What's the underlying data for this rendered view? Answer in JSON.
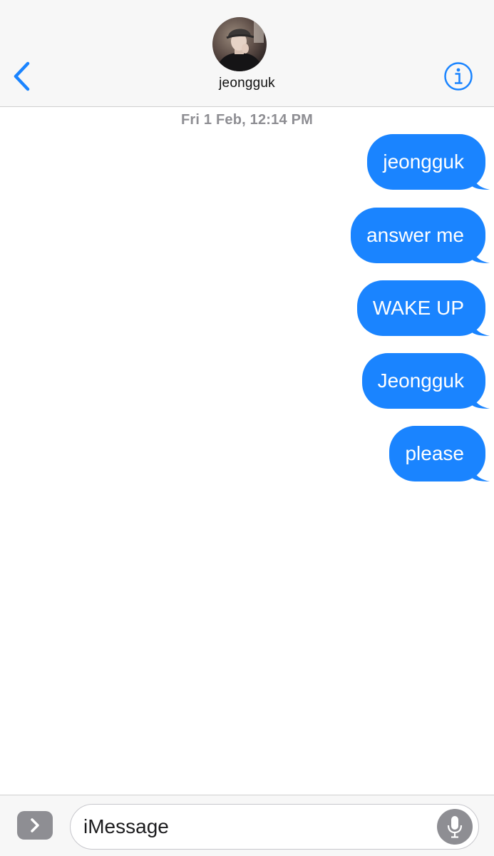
{
  "header": {
    "contact_name": "jeongguk",
    "avatar_icon": "contact-photo",
    "back_icon": "chevron-left-icon",
    "info_icon": "info-icon"
  },
  "conversation": {
    "timestamp": "Fri 1 Feb, 12:14 PM",
    "messages": [
      {
        "text": "jeongguk",
        "sender": "me"
      },
      {
        "text": "answer me",
        "sender": "me"
      },
      {
        "text": "WAKE UP",
        "sender": "me"
      },
      {
        "text": "Jeongguk",
        "sender": "me"
      },
      {
        "text": "please",
        "sender": "me"
      }
    ]
  },
  "composer": {
    "placeholder": "iMessage",
    "apps_icon": "chevron-right-icon",
    "mic_icon": "microphone-icon"
  },
  "colors": {
    "accent": "#1a84ff",
    "header_bg": "#f7f7f7",
    "timestamp": "#8e8e93"
  }
}
